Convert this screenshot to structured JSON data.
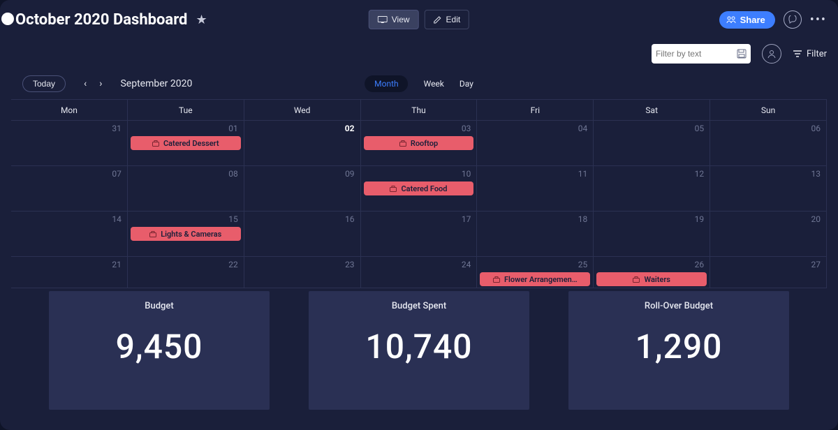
{
  "header": {
    "title": "October 2020 Dashboard",
    "view_label": "View",
    "edit_label": "Edit",
    "share_label": "Share"
  },
  "filterbar": {
    "placeholder": "Filter by text",
    "filter_label": "Filter"
  },
  "calendar_controls": {
    "today_label": "Today",
    "month_label": "September 2020",
    "views": {
      "month": "Month",
      "week": "Week",
      "day": "Day"
    }
  },
  "dayheads": [
    "Mon",
    "Tue",
    "Wed",
    "Thu",
    "Fri",
    "Sat",
    "Sun"
  ],
  "weeks": [
    [
      {
        "num": "31"
      },
      {
        "num": "01",
        "event": "Catered Dessert"
      },
      {
        "num": "02",
        "bold": true
      },
      {
        "num": "03",
        "event": "Rooftop"
      },
      {
        "num": "04"
      },
      {
        "num": "05"
      },
      {
        "num": "06"
      }
    ],
    [
      {
        "num": "07"
      },
      {
        "num": "08"
      },
      {
        "num": "09"
      },
      {
        "num": "10",
        "event": "Catered Food"
      },
      {
        "num": "11"
      },
      {
        "num": "12"
      },
      {
        "num": "13"
      }
    ],
    [
      {
        "num": "14"
      },
      {
        "num": "15",
        "event": "Lights & Cameras"
      },
      {
        "num": "16"
      },
      {
        "num": "17"
      },
      {
        "num": "18"
      },
      {
        "num": "19"
      },
      {
        "num": "20"
      }
    ],
    [
      {
        "num": "21"
      },
      {
        "num": "22"
      },
      {
        "num": "23"
      },
      {
        "num": "24"
      },
      {
        "num": "25",
        "event": "Flower Arrangemen…"
      },
      {
        "num": "26",
        "event": "Waiters"
      },
      {
        "num": "27"
      }
    ]
  ],
  "cards": {
    "budget": {
      "title": "Budget",
      "value": "9,450"
    },
    "spent": {
      "title": "Budget Spent",
      "value": "10,740"
    },
    "roll": {
      "title": "Roll-Over Budget",
      "value": "1,290"
    }
  }
}
